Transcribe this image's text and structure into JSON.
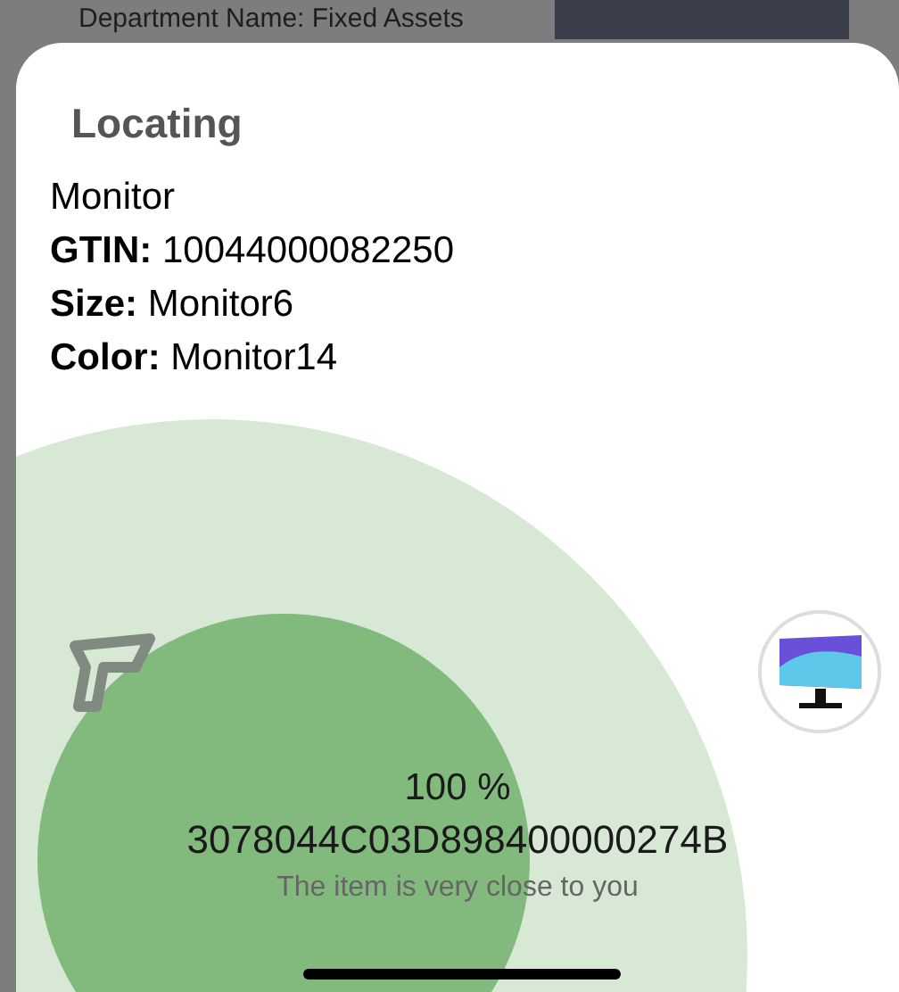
{
  "background": {
    "department": "Department Name: Fixed Assets"
  },
  "sheet": {
    "title": "Locating",
    "details": [
      "Monitor",
      "**GTIN:** 10044000082250",
      "**Size:** Monitor6",
      "**Color:** Monitor14"
    ],
    "percent": "100 %",
    "tag_id": "3078044C03D898400000274B",
    "message": "The item is very close to you"
  }
}
